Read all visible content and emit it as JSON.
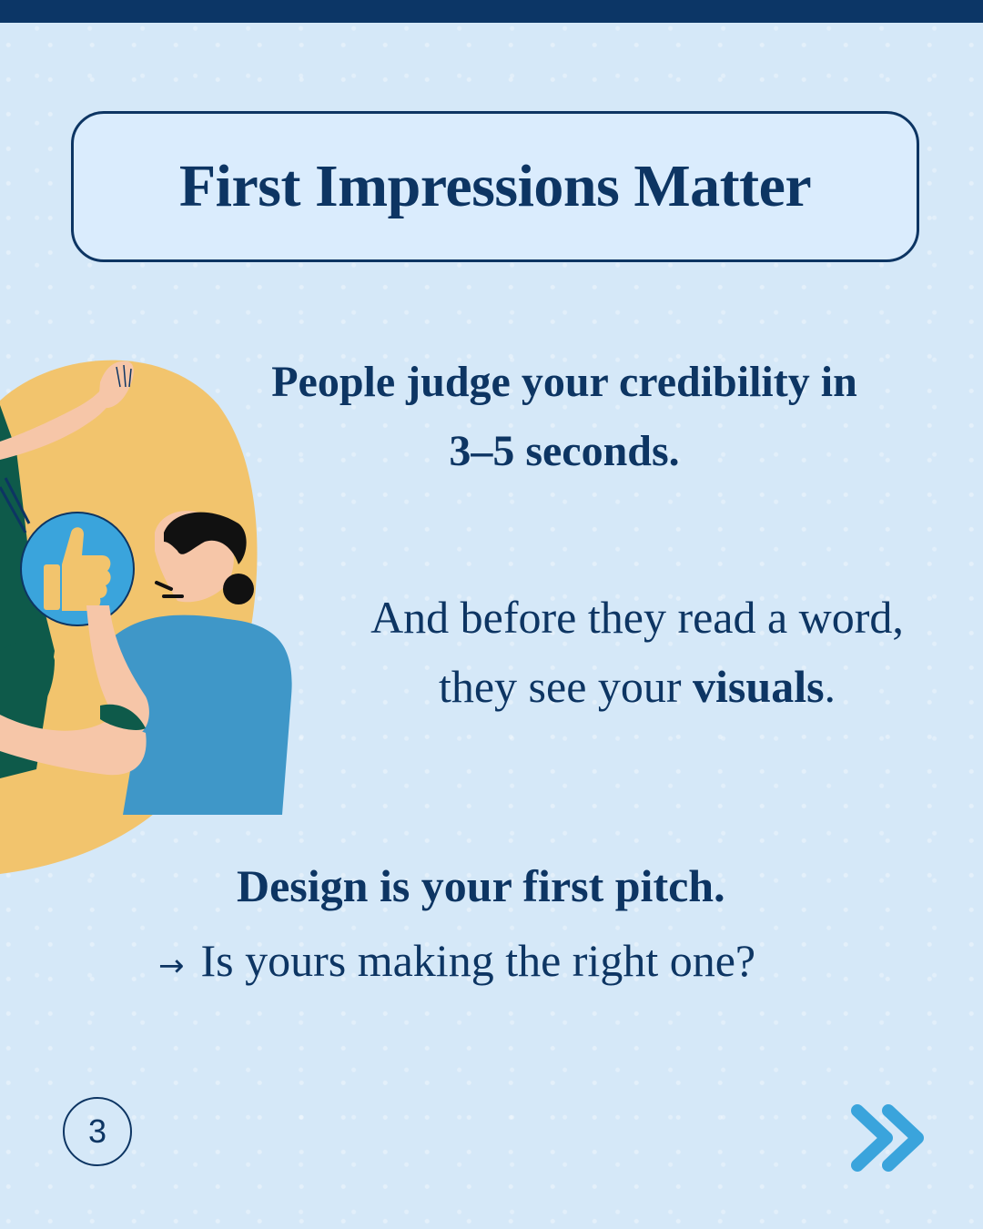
{
  "title": "First Impressions Matter",
  "paragraph1": {
    "line1": "People judge your credibility in",
    "line2": "3–5 seconds."
  },
  "paragraph2": {
    "line1": "And before they read a word,",
    "line2_prefix": "they see your ",
    "line2_emphasis": "visuals",
    "line2_suffix": "."
  },
  "paragraph3": {
    "line1": "Design is your first pitch.",
    "arrow": "→",
    "line2": "Is yours making the right one?"
  },
  "page_number": "3",
  "icons": {
    "next": "double-chevron-right-icon",
    "thumbs_up": "thumbs-up-icon"
  },
  "colors": {
    "background": "#d5e8f8",
    "navy": "#0d3563",
    "accent_blue": "#3aa4dc",
    "yellow": "#f2c46d"
  }
}
